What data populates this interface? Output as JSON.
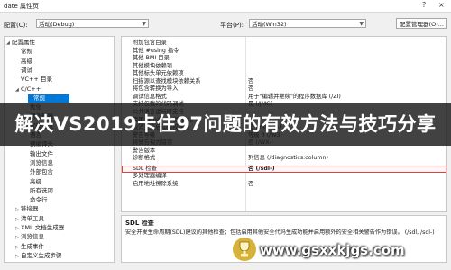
{
  "window": {
    "title": "date 属性页",
    "help": "?",
    "close": "×"
  },
  "toolbar": {
    "config_label": "配置(C):",
    "config_value": "活动(Debug)",
    "platform_label": "平台(P):",
    "platform_value": "活动(Win32)",
    "config_manager": "配置管理器(O)..."
  },
  "tree": {
    "items": [
      {
        "label": "配置属性",
        "indent": 0,
        "twisty": "◢"
      },
      {
        "label": "常规",
        "indent": 1,
        "twisty": ""
      },
      {
        "label": "高级",
        "indent": 1,
        "twisty": ""
      },
      {
        "label": "调试",
        "indent": 1,
        "twisty": ""
      },
      {
        "label": "VC++ 目录",
        "indent": 1,
        "twisty": ""
      },
      {
        "label": "C/C++",
        "indent": 1,
        "twisty": "◢"
      },
      {
        "label": "常规",
        "indent": 2,
        "twisty": ""
      },
      {
        "label": "优化",
        "indent": 2,
        "twisty": ""
      },
      {
        "label": "预处理器",
        "indent": 2,
        "twisty": ""
      },
      {
        "label": "代码生成",
        "indent": 2,
        "twisty": ""
      },
      {
        "label": "语言",
        "indent": 2,
        "twisty": ""
      },
      {
        "label": "预编译头",
        "indent": 2,
        "twisty": ""
      },
      {
        "label": "输出文件",
        "indent": 2,
        "twisty": ""
      },
      {
        "label": "浏览信息",
        "indent": 2,
        "twisty": ""
      },
      {
        "label": "外部包含",
        "indent": 2,
        "twisty": ""
      },
      {
        "label": "高级",
        "indent": 2,
        "twisty": ""
      },
      {
        "label": "所有选项",
        "indent": 2,
        "twisty": ""
      },
      {
        "label": "命令行",
        "indent": 2,
        "twisty": ""
      },
      {
        "label": "链接器",
        "indent": 1,
        "twisty": "▷"
      },
      {
        "label": "清单工具",
        "indent": 1,
        "twisty": "▷"
      },
      {
        "label": "XML 文档生成器",
        "indent": 1,
        "twisty": "▷"
      },
      {
        "label": "浏览信息",
        "indent": 1,
        "twisty": "▷"
      },
      {
        "label": "生成事件",
        "indent": 1,
        "twisty": "▷"
      },
      {
        "label": "自定义生成步骤",
        "indent": 1,
        "twisty": "▷"
      }
    ]
  },
  "grid": {
    "rows": [
      {
        "name": "附加包含目录",
        "value": ""
      },
      {
        "name": "其他 #using 指令",
        "value": ""
      },
      {
        "name": "其他 BMI 目录",
        "value": ""
      },
      {
        "name": "其他模块依赖项",
        "value": ""
      },
      {
        "name": "其他标头单元依赖项",
        "value": ""
      },
      {
        "name": "扫描源以查找模块依赖关系",
        "value": "否"
      },
      {
        "name": "将包含转换为导入",
        "value": "否"
      },
      {
        "name": "调试信息格式",
        "value": "用于\"编辑并继续\"的程序数据库 (/ZI)"
      },
      {
        "name": "支持仅我的代码调试",
        "value": "是 (/JMC)"
      },
      {
        "name": "公共语言运行时支持",
        "value": ""
      },
      {
        "name": "使用 Windows 运行时扩展",
        "value": ""
      },
      {
        "name": "取消显示启动版权标志",
        "value": "是 (/nologo)"
      },
      {
        "name": "警告等级",
        "value": "等级 3 (/W3)"
      },
      {
        "name": "将警告视为错误",
        "value": "否 (/WX-)"
      },
      {
        "name": "警告版本",
        "value": ""
      },
      {
        "name": "诊断格式",
        "value": "列信息 (/diagnostics:column)"
      },
      {
        "name": "SDL 检查",
        "value": "否 (/sdl-)"
      },
      {
        "name": "多处理器编译",
        "value": ""
      },
      {
        "name": "启用地址擦除系统",
        "value": "否"
      }
    ]
  },
  "description": {
    "title": "SDL 检查",
    "text": "安全开发生命周期(SDL)建议的其他检查；包括启用其他安全代码生成功能并启用额外的安全相关警告作为错误。    (/sdl, /sdl-)"
  },
  "banner": {
    "text": "解决VS2019卡住97问题的有效方法与技巧分享"
  },
  "watermark": {
    "text": "www.gsxxkjgs.com"
  }
}
